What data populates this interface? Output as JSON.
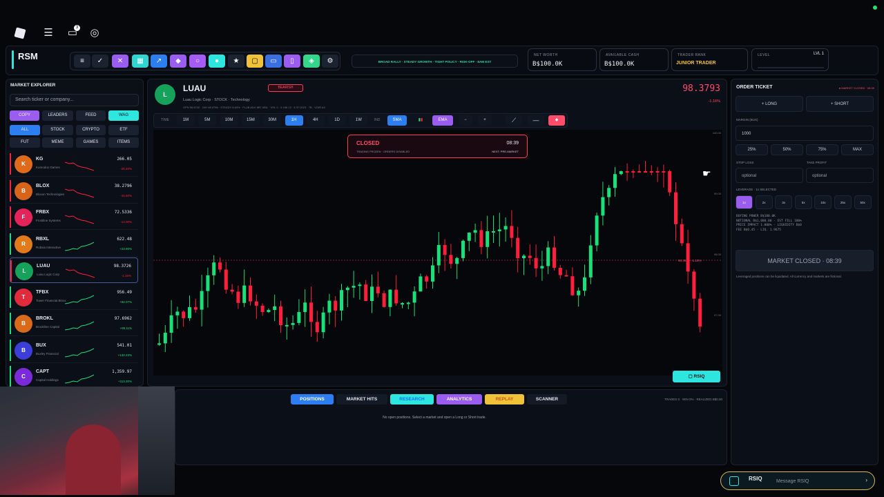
{
  "app": {
    "brand": "RSM",
    "notif_count": "3"
  },
  "ticker_banner": "BROAD RALLY · STEADY GROWTH · TIGHT POLICY · RISK-OFF · 8AM EST",
  "stats": [
    {
      "label": "NET WORTH",
      "value": "B$100.0K"
    },
    {
      "label": "AVAILABLE CASH",
      "value": "B$100.0K"
    },
    {
      "label": "TRADER RANK",
      "value": "JUNIOR TRADER"
    },
    {
      "label": "LEVEL",
      "value": "LVL 1"
    }
  ],
  "explorer": {
    "title": "MARKET EXPLORER",
    "search_placeholder": "Search ticker or company...",
    "views": [
      "COPY",
      "LEADERS",
      "FEED",
      "WAG"
    ],
    "categories": [
      "ALL",
      "STOCK",
      "CRYPTO",
      "ETF",
      "FUT",
      "MEME",
      "GAMES",
      "ITEMS"
    ],
    "rows": [
      {
        "letter": "K",
        "ticker": "KG",
        "name": "Komodos Games",
        "price": "266.05",
        "change": "-26.40%",
        "color": "#e06a1b",
        "up": false
      },
      {
        "letter": "B",
        "ticker": "BLOX",
        "name": "Bloxon Technologies",
        "price": "38.2796",
        "change": "-16.60%",
        "color": "#d8641a",
        "up": false
      },
      {
        "letter": "F",
        "ticker": "FRBX",
        "name": "Frostline Systems",
        "price": "72.5336",
        "change": "-14.00%",
        "color": "#e2245a",
        "up": false
      },
      {
        "letter": "R",
        "ticker": "RBXL",
        "name": "Robxia Interactive",
        "price": "622.48",
        "change": "+23.90%",
        "color": "#e07a1b",
        "up": true
      },
      {
        "letter": "L",
        "ticker": "LUAU",
        "name": "Luau Logic Corp",
        "price": "98.3726",
        "change": "-1.16%",
        "color": "#17a25c",
        "up": false
      },
      {
        "letter": "T",
        "ticker": "TFBX",
        "name": "Tower Financial Bloxx",
        "price": "956.49",
        "change": "+82.07%",
        "color": "#e02b3c",
        "up": true
      },
      {
        "letter": "B",
        "ticker": "BROKL",
        "name": "Brookline Capital",
        "price": "97.6962",
        "change": "+88.11%",
        "color": "#d86a1a",
        "up": true
      },
      {
        "letter": "B",
        "ticker": "BUX",
        "name": "Buxley Financial",
        "price": "541.01",
        "change": "+132.23%",
        "color": "#3b3fd8",
        "up": true
      },
      {
        "letter": "C",
        "ticker": "CAPT",
        "name": "Capital Holdings",
        "price": "1,359.97",
        "change": "+113.30%",
        "color": "#7a2ad8",
        "up": true
      }
    ]
  },
  "chart": {
    "ticker": "LUAU",
    "sentiment": "BEARISH",
    "subtitle": "Luau Logic Corp · STOCK · Technology",
    "stats_line": "OPN 98.8740 · 24H 98.9756 · STEADY 8.63% · FLUB ADV 8B7.0BIL · VOL 0 · 5 168 13 · 6 37.0023 · 7B · VOIR A3",
    "price": "98.3793",
    "change": "-1.16%",
    "time_label": "TIME",
    "timeframes": [
      "1M",
      "5M",
      "10M",
      "15M",
      "30M",
      "1H",
      "4H",
      "1D",
      "1W"
    ],
    "active_tf": "1H",
    "ind_label": "IND",
    "indicators": {
      "sma": "SMA",
      "ema": "EMA",
      "minus": "−",
      "plus": "+"
    },
    "closed_banner": {
      "title": "CLOSED",
      "time": "08:39",
      "line1": "TRADING FROZEN · ORDERS DISABLED",
      "line2": "NEXT: PRE-MARKET"
    },
    "axis_labels": [
      "100.00",
      "99.00",
      "98.00",
      "97.00"
    ],
    "price_tag": "98.38% · -1.16%",
    "rsiq_button": "RSIQ"
  },
  "bottom": {
    "tabs": [
      "POSITIONS",
      "MARKET HITS",
      "RESEARCH",
      "ANALYTICS",
      "REPLAY",
      "SCANNER"
    ],
    "stats": "TRADES 0 · WIN 0% · REALIZED B$0.00",
    "empty": "No open positions. Select a market and open a Long or Short trade."
  },
  "order": {
    "title": "ORDER TICKET",
    "status": "● MARKET CLOSED · 08:39",
    "long": "+ LONG",
    "short": "+ SHORT",
    "margin_label": "MARGIN (BUX)",
    "margin_value": "1000",
    "pcts": [
      "25%",
      "50%",
      "75%",
      "MAX"
    ],
    "sl_label": "STOP LOSS",
    "tp_label": "TAKE PROFIT",
    "sl_placeholder": "optional",
    "tp_placeholder": "optional",
    "leverage_label": "LEVERAGE · 1x SELECTED",
    "leverages": [
      "1x",
      "2x",
      "3x",
      "5x",
      "10x",
      "25x",
      "50x"
    ],
    "info1": "BUYING POWER  B$100.0K",
    "info2": "NOTIONAL  B$1,000.00  ·  EST FILL 100%",
    "info3": "PRICE IMPACT  1.000%  ·  LIQUIDITY B$0",
    "info4": "FEE  B$0.45  ·  LIQ. 1.9675",
    "closed_button": "MARKET CLOSED · 08:39",
    "disclaimer": "Leveraged positions can be liquidated. All currency and markets are fictional."
  },
  "chat": {
    "name": "RSIQ",
    "placeholder": "Message RSIQ"
  },
  "colors": {
    "bull": "#19e07a",
    "bear": "#ff1f3d",
    "accent": "#2ee6e0",
    "violet": "#a45cf5"
  }
}
